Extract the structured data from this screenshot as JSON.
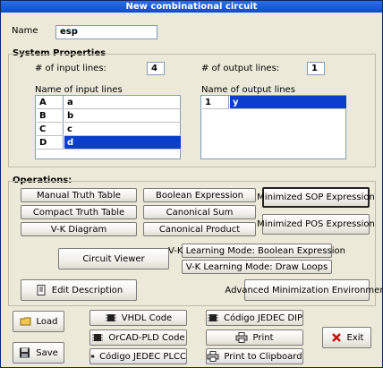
{
  "window": {
    "title": "New combinational circuit"
  },
  "name_field": {
    "label": "Name",
    "value": "esp"
  },
  "system": {
    "heading": "System Properties",
    "input_count_label": "# of input lines:",
    "input_count_value": "4",
    "output_count_label": "# of output lines:",
    "output_count_value": "1",
    "input_names_label": "Name of input lines",
    "output_names_label": "Name of output lines",
    "inputs": [
      {
        "key": "A",
        "name": "a"
      },
      {
        "key": "B",
        "name": "b"
      },
      {
        "key": "C",
        "name": "c"
      },
      {
        "key": "D",
        "name": "d"
      }
    ],
    "outputs": [
      {
        "key": "1",
        "name": "y"
      }
    ]
  },
  "operations": {
    "heading": "Operations:",
    "manual_truth_table": "Manual Truth Table",
    "compact_truth_table": "Compact Truth Table",
    "vk_diagram": "V-K Diagram",
    "boolean_expression": "Boolean Expression",
    "canonical_sum": "Canonical Sum",
    "canonical_product": "Canonical Product",
    "minimized_sop": "Minimized SOP Expression",
    "minimized_pos": "Minimized POS Expression",
    "circuit_viewer": "Circuit Viewer",
    "vk_learning_boolean": "V-K Learning Mode: Boolean Expression",
    "vk_learning_loops": "V-K Learning Mode: Draw Loops",
    "edit_description": "Edit Description",
    "advanced_min": "Advanced Minimization Environment"
  },
  "bottom": {
    "load": "Load",
    "save": "Save",
    "vhdl": "VHDL Code",
    "orcad": "OrCAD-PLD Code",
    "jedec_plcc": "Código JEDEC PLCC",
    "jedec_dip": "Código JEDEC DIP",
    "print": "Print",
    "print_clipboard": "Print to Clipboard",
    "exit": "Exit"
  },
  "colors": {
    "selection": "#0a3ecb",
    "titlebar": "#0b4bd1",
    "face": "#ece9d8"
  }
}
